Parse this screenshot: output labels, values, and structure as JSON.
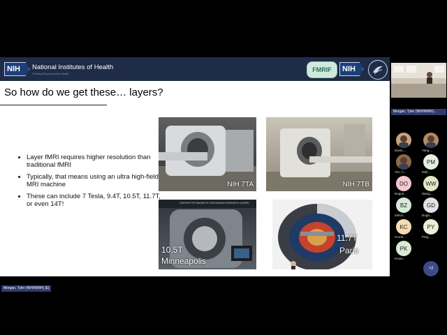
{
  "header": {
    "org_name": "National Institutes of Health",
    "org_tagline": "Turning Discovery Into Health",
    "nih_logo": "NIH",
    "fmrif_logo": "FMRIF",
    "nih_logo_right": "NIH"
  },
  "slide": {
    "title": "So how do we get these… layers?",
    "bullets": [
      "Layer fMRI requires higher resolution than traditional fMRI",
      "Typically, that means using an ultra high-field MRI machine",
      "These can include 7 Tesla, 9.4T, 10.5T, 11.7T, or even 14T!"
    ],
    "photos": [
      {
        "caption": "NIH 7TA"
      },
      {
        "caption": "NIH 7TB"
      },
      {
        "caption_line1": "10.5T",
        "caption_line2": "Minneapolis",
        "banner": "CENTER FOR MAGNETIC RESONANCE RESEARCH (CMRR)"
      },
      {
        "caption_line1": "11.7T",
        "caption_line2": "Paris"
      }
    ]
  },
  "participants": {
    "active_speaker": "Morgan, Tyler (NIH/NIMH)...",
    "people": [
      {
        "initials": "",
        "name": "Davis,...",
        "photo": true,
        "color": "#c9a27e"
      },
      {
        "initials": "",
        "name": "Yang,...",
        "photo": true,
        "color": "#b08a6a"
      },
      {
        "initials": "",
        "name": "Yeo, C...",
        "photo": true,
        "color": "#8a6a4a"
      },
      {
        "initials": "PM",
        "name": "Moll...",
        "photo": false,
        "color": "#e6efe3"
      },
      {
        "initials": "DO",
        "name": "Nogue...",
        "photo": false,
        "color": "#f2c8cf"
      },
      {
        "initials": "WW",
        "name": "Wang,...",
        "photo": false,
        "color": "#e4e7c6"
      },
      {
        "initials": "BZ",
        "name": "Zelick...",
        "photo": false,
        "color": "#d6e9d6"
      },
      {
        "initials": "GD",
        "name": "Duga...",
        "photo": false,
        "color": "#dfe2e6"
      },
      {
        "initials": "KC",
        "name": "Crook...",
        "photo": false,
        "color": "#f2dcb0"
      },
      {
        "initials": "PY",
        "name": "Ping,...",
        "photo": false,
        "color": "#ecedd2"
      },
      {
        "initials": "PK",
        "name": "Kreye...",
        "photo": false,
        "color": "#d8ead2"
      }
    ],
    "more_label": "+2"
  },
  "speaker_label": "Morgan, Tyler (NIH/NIMH) [E]"
}
